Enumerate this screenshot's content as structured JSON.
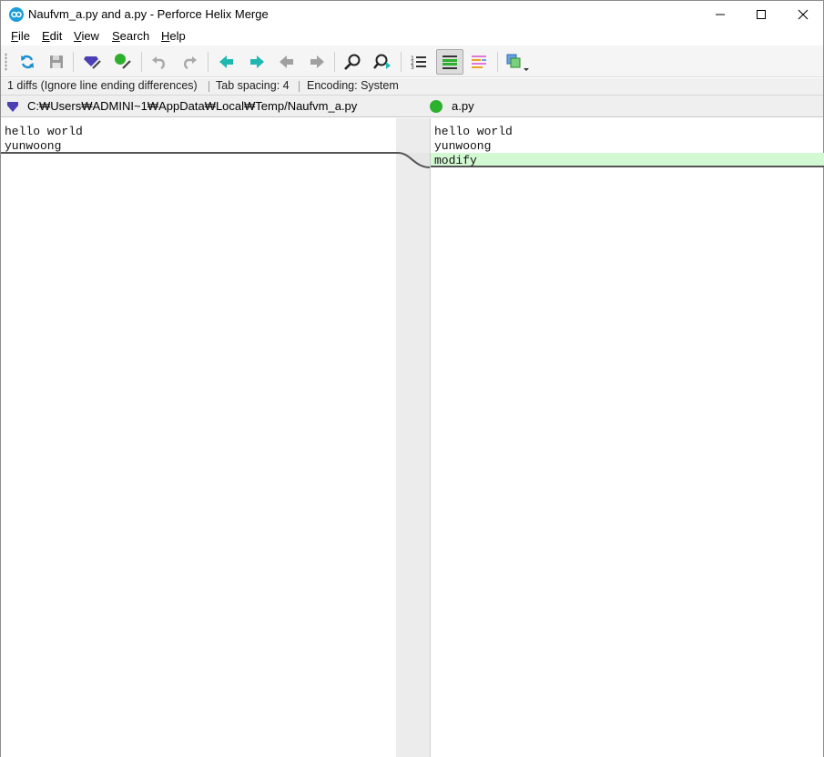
{
  "window": {
    "title": "Naufvm_a.py and a.py - Perforce Helix Merge"
  },
  "menu": {
    "file": {
      "label": "ile",
      "accel": "F"
    },
    "edit": {
      "label": "dit",
      "accel": "E"
    },
    "view": {
      "label": "iew",
      "accel": "V"
    },
    "search": {
      "label": "earch",
      "accel": "S"
    },
    "help": {
      "label": "elp",
      "accel": "H"
    }
  },
  "status": {
    "diffs": "1 diffs (Ignore line ending differences)",
    "tab_spacing": "Tab spacing: 4",
    "encoding": "Encoding: System"
  },
  "left_file": {
    "path": "C:₩Users₩ADMINI~1₩AppData₩Local₩Temp/Naufvm_a.py",
    "lines": [
      "hello world",
      "yunwoong"
    ]
  },
  "right_file": {
    "name": "a.py",
    "lines": [
      "hello world",
      "yunwoong",
      "modify"
    ]
  },
  "colors": {
    "accent": "#1a9fd9",
    "added_bg": "#d2f9d2",
    "left_marker": "#4b3fb5",
    "right_marker": "#2db02d",
    "nav_arrow": "#1fb8b0"
  },
  "icons": {
    "refresh": "refresh-icon",
    "save": "save-icon",
    "left_file": "diamond-icon",
    "right_file": "circle-icon"
  }
}
